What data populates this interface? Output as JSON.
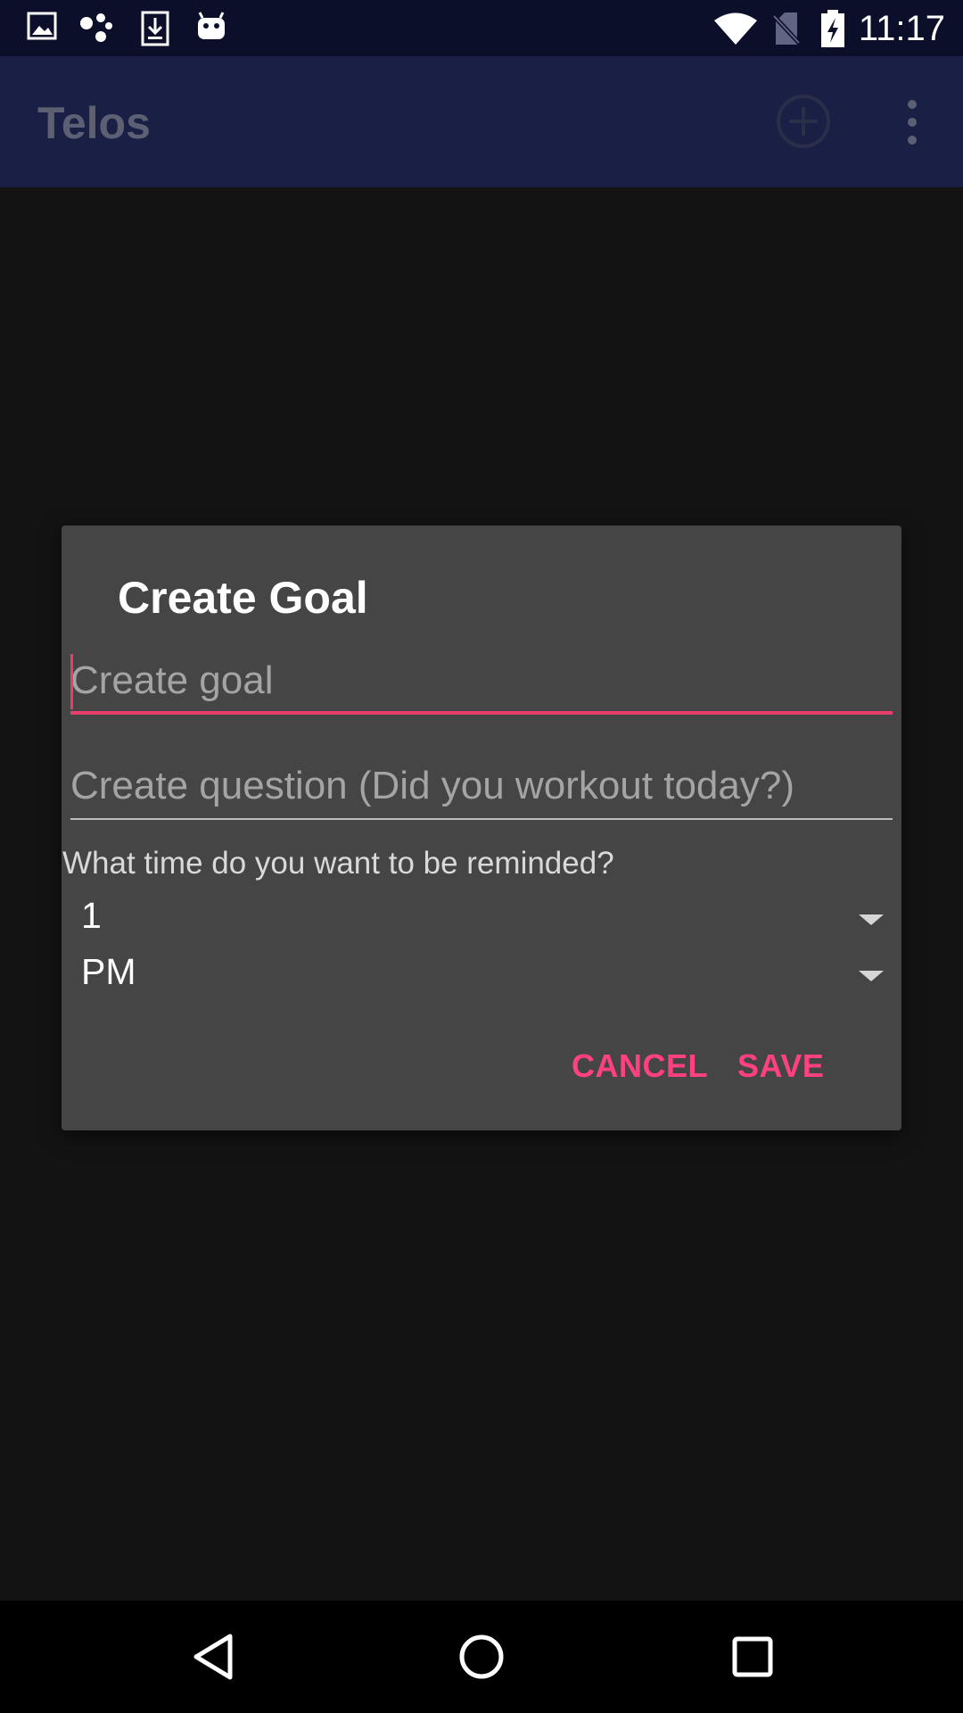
{
  "status_bar": {
    "time": "11:17",
    "left_icons": [
      "image-icon",
      "assistant-dots-icon",
      "download-icon",
      "android-icon"
    ],
    "right_icons": [
      "wifi-icon",
      "no-sim-icon",
      "battery-charging-icon"
    ]
  },
  "app_bar": {
    "title": "Telos",
    "actions": [
      "add-circle-icon",
      "overflow-menu-icon"
    ]
  },
  "dialog": {
    "title": "Create Goal",
    "goal_field": {
      "placeholder": "Create goal",
      "value": ""
    },
    "question_field": {
      "placeholder": "Create question (Did you workout today?)",
      "value": ""
    },
    "reminder_label": "What time do you want to be reminded?",
    "hour_spinner": {
      "selected": "1"
    },
    "ampm_spinner": {
      "selected": "PM"
    },
    "cancel_label": "CANCEL",
    "save_label": "SAVE"
  },
  "nav_bar": {
    "buttons": [
      "back-icon",
      "home-icon",
      "recents-icon"
    ]
  },
  "colors": {
    "status_bar": "#0c0f29",
    "app_bar": "#1a1f45",
    "background": "#131313",
    "dialog": "#454545",
    "accent": "#ff4081",
    "focus_line": "#e83e6e"
  }
}
